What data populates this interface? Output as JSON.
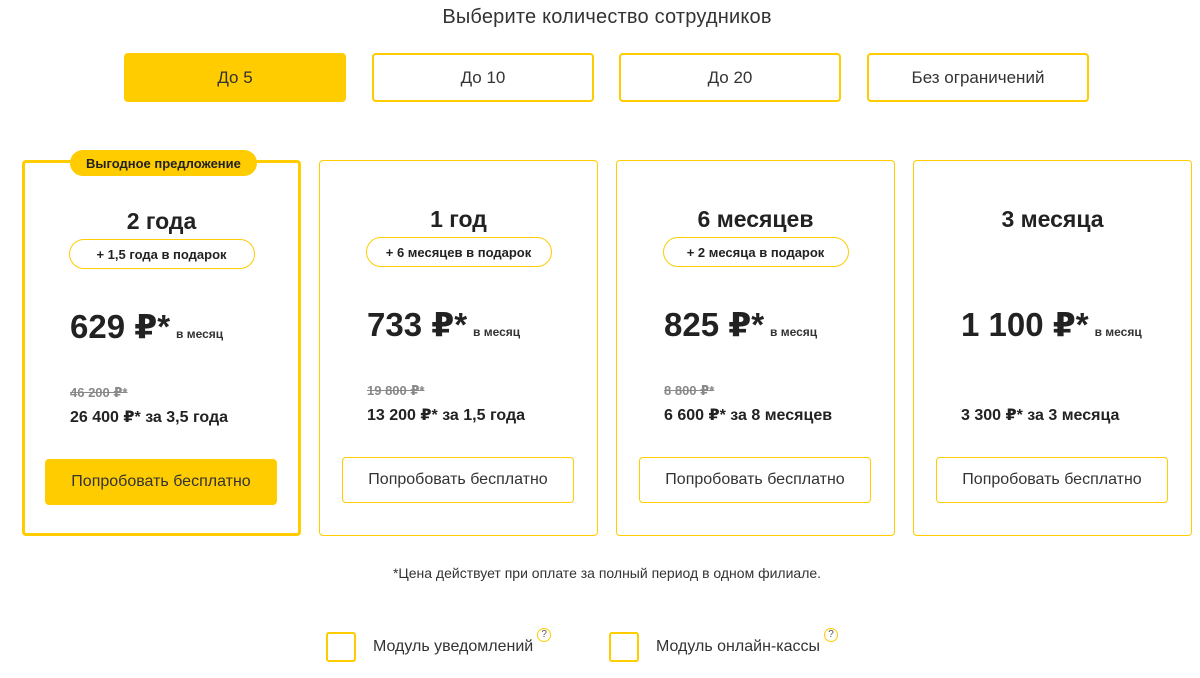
{
  "heading": "Выберите количество сотрудников",
  "team_sizes": [
    "До 5",
    "До 10",
    "До 20",
    "Без ограничений"
  ],
  "active_team_size": "До 5",
  "plans": [
    {
      "badge": "Выгодное предложение",
      "period": "2 года",
      "bonus": "+ 1,5 года в подарок",
      "price": "629 ₽*",
      "per": "в месяц",
      "old_price": "46 200 ₽*",
      "total": "26 400 ₽* за 3,5 года",
      "cta": "Попробовать бесплатно"
    },
    {
      "period": "1 год",
      "bonus": "+ 6 месяцев в подарок",
      "price": "733 ₽*",
      "per": "в месяц",
      "old_price": "19 800 ₽*",
      "total": "13 200 ₽* за 1,5 года",
      "cta": "Попробовать бесплатно"
    },
    {
      "period": "6 месяцев",
      "bonus": "+ 2 месяца в подарок",
      "price": "825 ₽*",
      "per": "в месяц",
      "old_price": "8 800 ₽*",
      "total": "6 600 ₽* за 8 месяцев",
      "cta": "Попробовать бесплатно"
    },
    {
      "period": "3 месяца",
      "price": "1 100 ₽*",
      "per": "в месяц",
      "total": "3 300 ₽* за 3 месяца",
      "cta": "Попробовать бесплатно"
    }
  ],
  "footnote": "*Цена действует при оплате за полный период в одном филиале.",
  "modules": [
    {
      "label": "Модуль уведомлений",
      "help": "?"
    },
    {
      "label": "Модуль онлайн-кассы",
      "help": "?"
    }
  ],
  "colors": {
    "accent": "#ffcc00"
  }
}
